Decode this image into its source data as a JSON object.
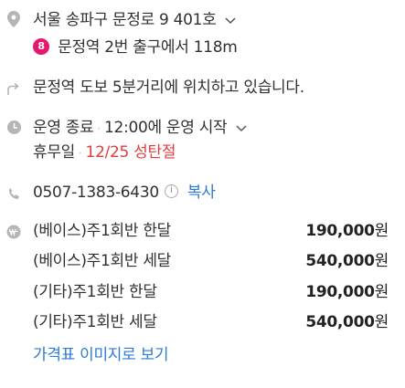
{
  "address": {
    "text": "서울 송파구 문정로 9 401호",
    "icon": "location-pin-icon"
  },
  "subway": {
    "line_number": "8",
    "line_color": "#e6186c",
    "text": "문정역 2번 출구에서 118m"
  },
  "directions": {
    "text": "문정역 도보 5분거리에 위치하고 있습니다.",
    "icon": "directions-arrow-icon"
  },
  "hours": {
    "status": "운영 종료",
    "separator": "·",
    "next": "12:00에 운영 시작",
    "holiday_label": "휴무일",
    "holiday_value": "12/25 성탄절",
    "icon": "clock-icon"
  },
  "phone": {
    "number": "0507-1383-6430",
    "info_glyph": "i",
    "copy_label": "복사",
    "icon": "phone-icon"
  },
  "prices": {
    "icon": "won-price-icon",
    "items": [
      {
        "name": "(베이스)주1회반 한달",
        "value": "190,000",
        "unit": "원"
      },
      {
        "name": "(베이스)주1회반 세달",
        "value": "540,000",
        "unit": "원"
      },
      {
        "name": "(기타)주1회반 한달",
        "value": "190,000",
        "unit": "원"
      },
      {
        "name": "(기타)주1회반 세달",
        "value": "540,000",
        "unit": "원"
      }
    ],
    "view_image_link": "가격표 이미지로 보기"
  },
  "colors": {
    "link": "#2a7ad6",
    "holiday": "#e03c3c",
    "icon_gray": "#b5b5b5"
  }
}
